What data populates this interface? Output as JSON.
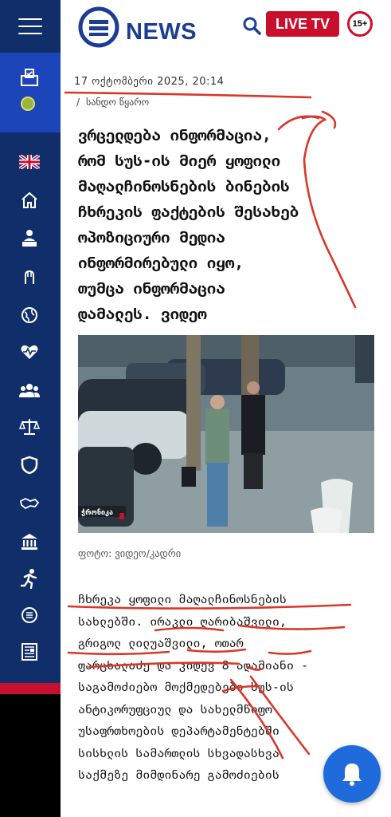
{
  "header": {
    "logo_text": "NEWS",
    "live_label": "LIVE TV",
    "age_rating": "15+"
  },
  "sidebar": {
    "icons": [
      "ballot-box-icon",
      "status-dot-icon",
      "uk-flag-icon",
      "home-icon",
      "speaker-icon",
      "fist-icon",
      "globe-icon",
      "heartbeat-icon",
      "people-icon",
      "scales-icon",
      "shield-icon",
      "map-icon",
      "bank-icon",
      "running-icon",
      "money-icon",
      "newspaper-icon"
    ]
  },
  "article": {
    "date": "17 ოქტომბერი 2025, 20:14",
    "source_separator": "/",
    "source": "სანდო წყარო",
    "title_lines": [
      "ვრცელდება ინფორმაცია,",
      "რომ სუს-ის მიერ ყოფილი",
      "მაღალჩინოსნების ბინების",
      "ჩხრეკის ფაქტების შესახებ",
      "ოპოზიციური მედია",
      "ინფორმირებული იყო,",
      "თუმცა ინფორმაცია",
      "დამალეს. ვიდეო"
    ],
    "photo_watermark": "ჭრონიკა",
    "caption": "ფოტო: ვიდეო/კადრი",
    "body_lines": [
      "ჩხრეკა ყოფილი მაღალჩინოსნების",
      "სახლებში. ირაკლი ღარიბაშვილი,",
      "გრიგოლ ლილუაშვილი, ოთარ",
      "ფარცხალაძე და კიდევ 8 ადამიანი -",
      "საგამოძიებო მოქმედებები სუს-ის",
      "ანტიკორუფციულ და სახელმწიფო",
      "უსაფრთხოების დეპარტამენტებში",
      "სისხლის სამართლის სხვადასხვა",
      "საქმეზე მიმდინარე გამოძიების"
    ]
  },
  "colors": {
    "sidebar": "#0f2e6a",
    "sidebar_active": "#1b45b8",
    "brand_blue": "#1b3d93",
    "live_red": "#c8102e",
    "annotation_red": "#d8382a",
    "bell_blue": "#1f6bdb"
  }
}
